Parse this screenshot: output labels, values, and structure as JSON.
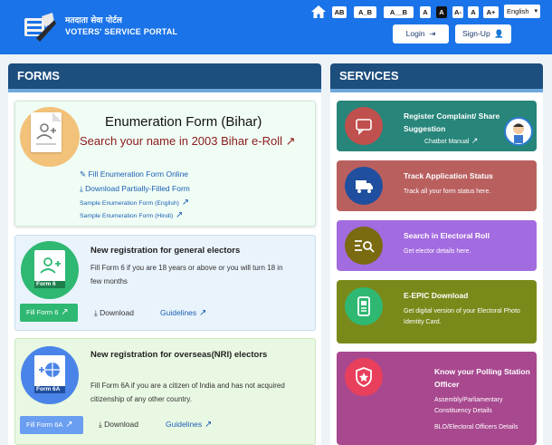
{
  "header": {
    "logo_hindi": "मतदाता सेवा पोर्टल",
    "logo_english": "VOTERS' SERVICE PORTAL",
    "font_controls": [
      "AB",
      "A_B",
      "A__B",
      "A",
      "A",
      "A-",
      "A",
      "A+"
    ],
    "language": "English",
    "login_label": "Login",
    "signup_label": "Sign-Up"
  },
  "forms": {
    "heading": "FORMS",
    "enumeration": {
      "title": "Enumeration Form (Bihar)",
      "search_text": "Search your name in 2003 Bihar e-Roll",
      "fill_online": "Fill Enumeration Form Online",
      "download_partial": "Download Partially-Filled Form",
      "sample_english": "Sample Enumeration Form (English)",
      "sample_hindi": "Sample Enumeration Form (Hindi)"
    },
    "general": {
      "badge": "Form 6",
      "title": "New registration for general electors",
      "description": "Fill Form 6 if you are 18 years or above or you will turn 18 in few months",
      "fill_button": "Fill Form 6",
      "download": "Download",
      "guidelines": "Guidelines"
    },
    "overseas": {
      "badge": "Form 6A",
      "title": "New registration for overseas(NRI) electors",
      "description": "Fill Form 6A if you are a citizen of India and has not acquired citizenship of any other country.",
      "fill_button": "Fill Form 6A",
      "download": "Download",
      "guidelines": "Guidelines"
    }
  },
  "services": {
    "heading": "SERVICES",
    "items": [
      {
        "title": "Register Complaint/ Share Suggestion",
        "sub": "Chatbot Manual",
        "color": "#27857a"
      },
      {
        "title": "Track Application Status",
        "sub": "Track all your form status here.",
        "color": "#b9605f"
      },
      {
        "title": "Search in Electoral Roll",
        "sub": "Get elector details here.",
        "color": "#a36be0"
      },
      {
        "title": "E-EPIC Download",
        "sub": "Get digital version of your Electoral Photo Identity Card.",
        "color": "#7a8a1a"
      },
      {
        "title": "Know your Polling Station Officer",
        "sub": "Assembly/Parliamentary Constituency Details",
        "sub2": "BLO/Electoral Officers Details",
        "color": "#a8488f"
      }
    ]
  }
}
